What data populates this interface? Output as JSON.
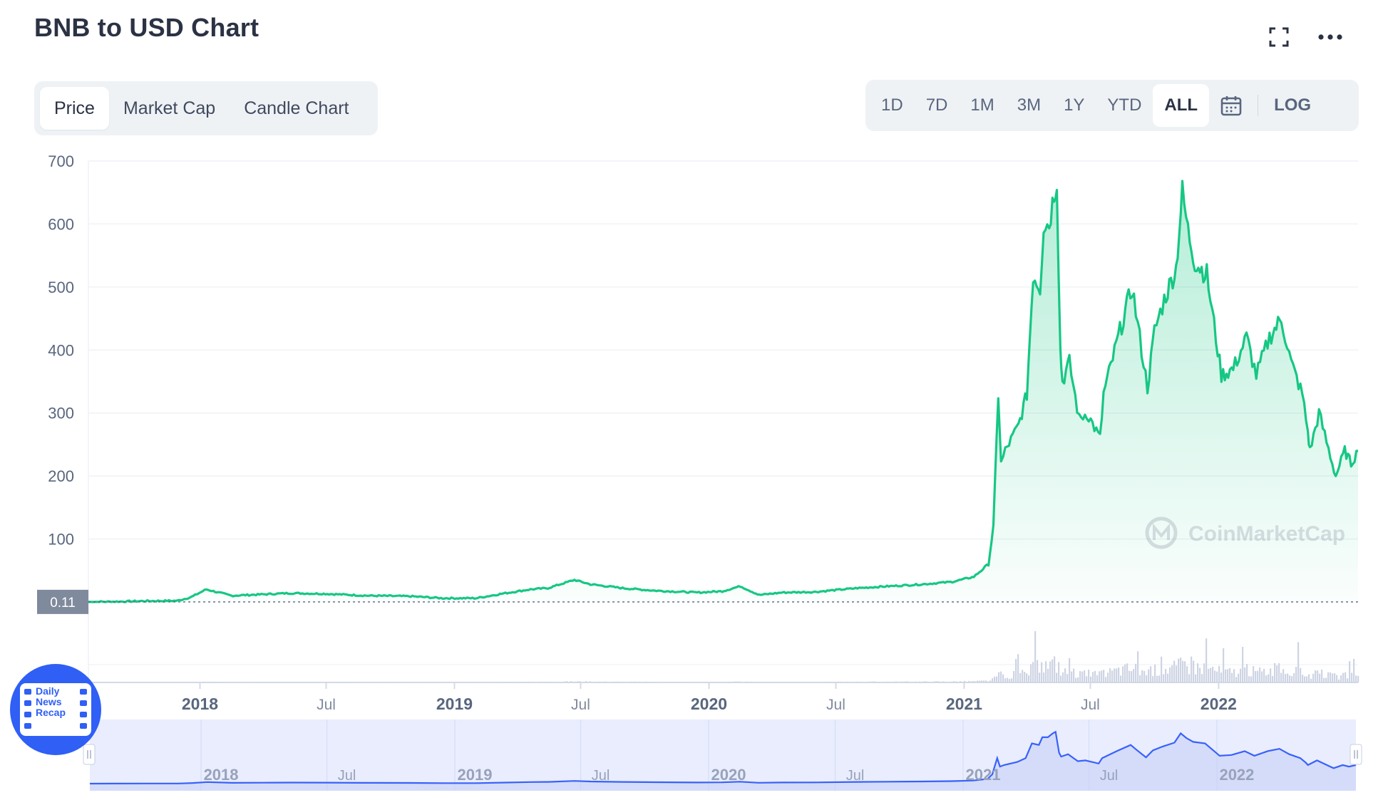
{
  "header": {
    "title": "BNB to USD Chart"
  },
  "tabs": [
    {
      "label": "Price",
      "active": true
    },
    {
      "label": "Market Cap",
      "active": false
    },
    {
      "label": "Candle Chart",
      "active": false
    }
  ],
  "ranges": [
    {
      "label": "1D",
      "active": false
    },
    {
      "label": "7D",
      "active": false
    },
    {
      "label": "1M",
      "active": false
    },
    {
      "label": "3M",
      "active": false
    },
    {
      "label": "1Y",
      "active": false
    },
    {
      "label": "YTD",
      "active": false
    },
    {
      "label": "ALL",
      "active": true
    }
  ],
  "log_label": "LOG",
  "icons": {
    "fullscreen": "fullscreen-icon",
    "more": "more-icon",
    "calendar": "calendar-icon"
  },
  "colors": {
    "line": "#16c784",
    "navigator": "#3861fb",
    "volume": "#c9cfe0",
    "tag": "#808a9d"
  },
  "watermark": "CoinMarketCap",
  "badge_lines": [
    "Daily",
    "News",
    "Recap"
  ],
  "chart_data": {
    "type": "area",
    "title": "",
    "xlabel": "",
    "ylabel": "",
    "ylim": [
      0,
      700
    ],
    "y_ticks": [
      100,
      200,
      300,
      400,
      500,
      600,
      700
    ],
    "current_price_label": "0.11",
    "x_axis_labels": [
      "2018",
      "Jul",
      "2019",
      "Jul",
      "2020",
      "Jul",
      "2021",
      "Jul",
      "2022"
    ],
    "navigator_labels": [
      "2018",
      "Jul",
      "2019",
      "Jul",
      "2020",
      "Jul",
      "2021",
      "Jul",
      "2022"
    ],
    "x_domain": [
      "2017-07-25",
      "2022-07-20"
    ],
    "grid": true,
    "legend": "none",
    "series": [
      {
        "x": [
          "2017-07-25",
          "2017-09-01",
          "2017-10-15",
          "2017-11-30",
          "2017-12-20",
          "2018-01-10",
          "2018-02-15",
          "2018-03-30",
          "2018-05-10",
          "2018-06-30",
          "2018-08-30",
          "2018-10-30",
          "2018-12-15",
          "2019-02-01",
          "2019-03-15",
          "2019-04-20",
          "2019-05-15",
          "2019-06-22",
          "2019-07-15",
          "2019-08-30",
          "2019-10-15",
          "2019-12-15",
          "2020-01-20",
          "2020-02-15",
          "2020-03-13",
          "2020-04-15",
          "2020-06-01",
          "2020-08-01",
          "2020-09-15",
          "2020-11-01",
          "2020-12-15",
          "2021-01-15",
          "2021-02-05",
          "2021-02-12",
          "2021-02-19",
          "2021-02-23",
          "2021-03-01",
          "2021-03-20",
          "2021-04-01",
          "2021-04-10",
          "2021-04-20",
          "2021-04-25",
          "2021-05-03",
          "2021-05-10",
          "2021-05-14",
          "2021-05-19",
          "2021-05-22",
          "2021-06-01",
          "2021-06-15",
          "2021-06-26",
          "2021-07-15",
          "2021-07-20",
          "2021-08-10",
          "2021-08-30",
          "2021-09-07",
          "2021-09-21",
          "2021-10-01",
          "2021-10-15",
          "2021-11-01",
          "2021-11-10",
          "2021-11-18",
          "2021-11-28",
          "2021-12-15",
          "2022-01-05",
          "2022-01-22",
          "2022-02-10",
          "2022-02-24",
          "2022-03-15",
          "2022-04-01",
          "2022-04-15",
          "2022-05-01",
          "2022-05-09",
          "2022-05-12",
          "2022-05-25",
          "2022-06-13",
          "2022-06-18",
          "2022-07-01",
          "2022-07-10",
          "2022-07-20"
        ],
        "y": [
          0.11,
          0.5,
          1.5,
          2,
          8,
          20,
          10,
          12,
          14,
          13,
          10,
          9,
          6,
          6,
          14,
          20,
          22,
          35,
          28,
          22,
          18,
          15,
          17,
          25,
          11,
          15,
          16,
          22,
          25,
          28,
          32,
          40,
          60,
          120,
          330,
          220,
          240,
          280,
          330,
          520,
          500,
          600,
          600,
          650,
          670,
          400,
          350,
          380,
          290,
          300,
          260,
          330,
          420,
          500,
          440,
          340,
          430,
          480,
          530,
          650,
          590,
          540,
          520,
          360,
          370,
          420,
          360,
          420,
          450,
          380,
          330,
          270,
          240,
          300,
          220,
          200,
          240,
          220,
          240
        ]
      }
    ]
  }
}
